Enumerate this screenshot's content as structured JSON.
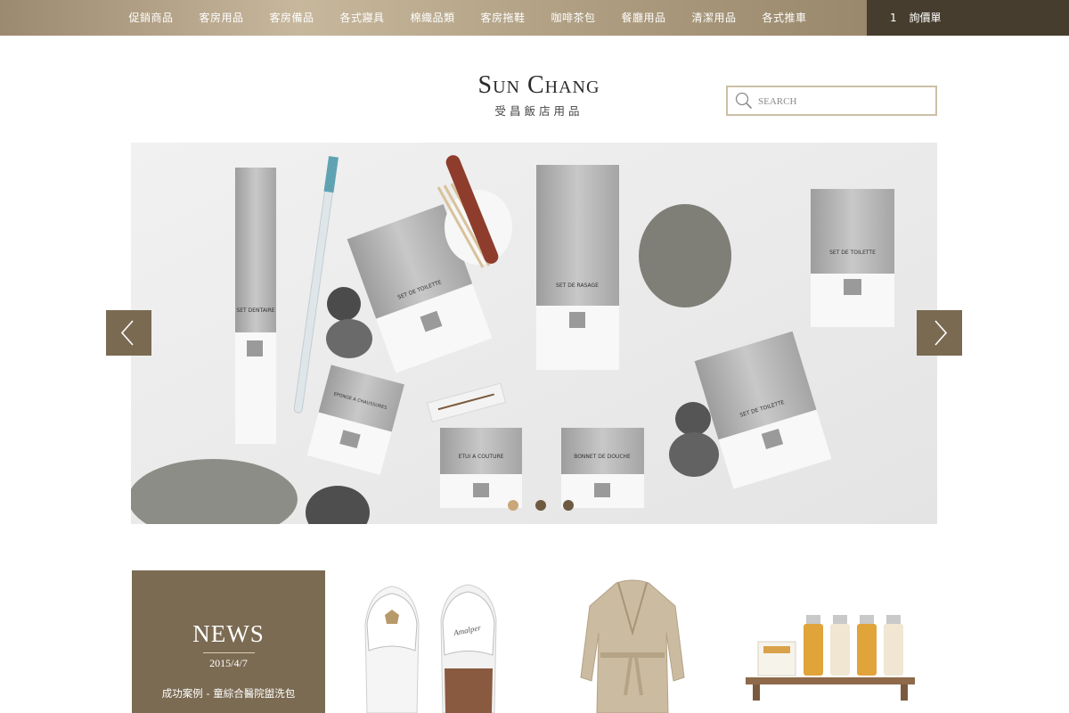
{
  "nav": {
    "items": [
      "促銷商品",
      "客房用品",
      "客房備品",
      "各式寢具",
      "棉織品類",
      "客房拖鞋",
      "咖啡茶包",
      "餐廳用品",
      "清潔用品",
      "各式推車"
    ],
    "inquiry_count": "1",
    "inquiry_label": "詢價單"
  },
  "logo": {
    "en": "Sun Chang",
    "zh": "受昌飯店用品"
  },
  "search": {
    "placeholder": "SEARCH"
  },
  "hero": {
    "product_labels": [
      "SET DENTAIRE",
      "SET DE TOILETTE",
      "SET DE RASAGE",
      "SET DE TOILETTE",
      "EPONGE A CHAUSSURES",
      "ETUI A COUTURE",
      "BONNET DE DOUCHE",
      "SET DE TOILETTE"
    ],
    "slide_count": 3,
    "active_slide": 1
  },
  "news": {
    "title": "NEWS",
    "date": "2015/4/7",
    "headline": "成功案例 - 童綜合醫院盥洗包"
  },
  "products": [
    {
      "icon": "slippers-image",
      "slipper_text": "Amalper"
    },
    {
      "icon": "bathrobe-image"
    },
    {
      "icon": "toiletries-set-image"
    }
  ],
  "colors": {
    "accent": "#7b6b52",
    "dark": "#463d2f",
    "dot_active": "#caa779"
  }
}
